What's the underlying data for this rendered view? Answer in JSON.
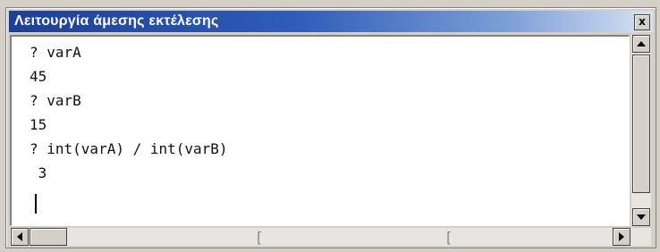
{
  "window": {
    "title": "Λειτουργία άμεσης εκτέλεσης",
    "close_label": "x"
  },
  "editor": {
    "lines": [
      "? varA",
      "45",
      "? varB",
      "15",
      "? int(varA) / int(varB)",
      " 3"
    ]
  },
  "icons": {
    "close": "close-icon",
    "scroll_up": "arrow-up-icon",
    "scroll_down": "arrow-down-icon",
    "scroll_left": "arrow-left-icon",
    "scroll_right": "arrow-right-icon"
  },
  "colors": {
    "title_gradient_start": "#1e3f95",
    "title_gradient_end": "#d8e2f2",
    "chrome": "#d4d0c8"
  }
}
